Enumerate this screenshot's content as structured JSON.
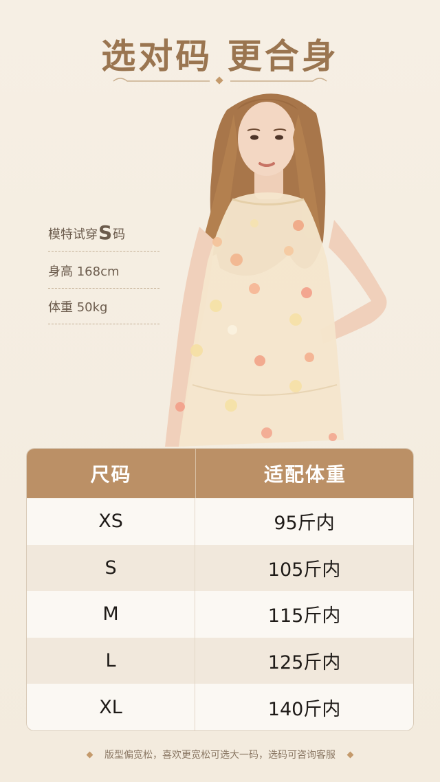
{
  "header": {
    "title": "选对码 更合身"
  },
  "model_specs": {
    "tried_prefix": "模特试穿",
    "tried_size": "S",
    "tried_suffix": "码",
    "height": "身高 168cm",
    "weight": "体重 50kg"
  },
  "size_table": {
    "headers": {
      "size": "尺码",
      "weight": "适配体重"
    },
    "rows": [
      {
        "size": "XS",
        "weight": "95斤内"
      },
      {
        "size": "S",
        "weight": "105斤内"
      },
      {
        "size": "M",
        "weight": "115斤内"
      },
      {
        "size": "L",
        "weight": "125斤内"
      },
      {
        "size": "XL",
        "weight": "140斤内"
      }
    ]
  },
  "footer": {
    "note": "版型偏宽松，喜欢更宽松可选大一码，选码可咨询客服"
  },
  "colors": {
    "accent": "#bb9066",
    "title": "#9a7550",
    "background": "#f5eee3"
  }
}
